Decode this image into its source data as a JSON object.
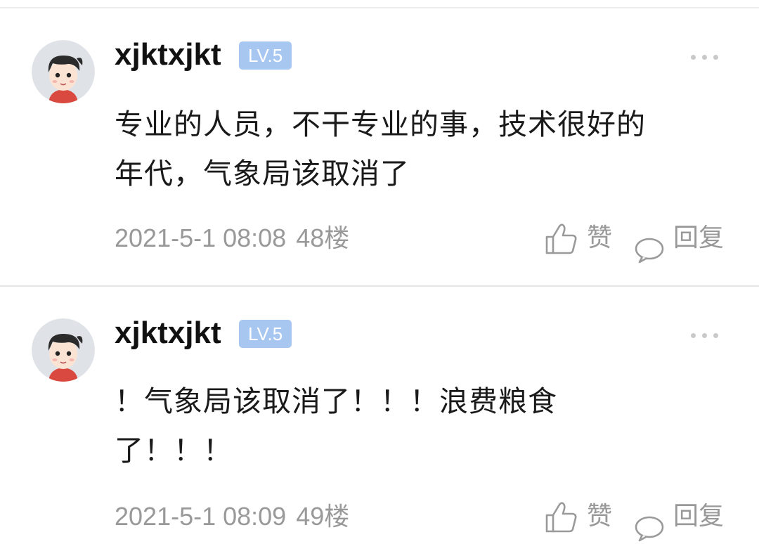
{
  "comments": [
    {
      "username": "xjktxjkt",
      "level": "LV.5",
      "content_lines": [
        "专业的人员，不干专业的事，技术很好的",
        "年代，气象局该取消了"
      ],
      "time": "2021-5-1 08:08",
      "floor": "48楼",
      "like_label": "赞",
      "reply_label": "回复"
    },
    {
      "username": "xjktxjkt",
      "level": "LV.5",
      "content_lines": [
        "！气象局该取消了！！！浪费粮食",
        "了！！！"
      ],
      "time": "2021-5-1 08:09",
      "floor": "49楼",
      "like_label": "赞",
      "reply_label": "回复"
    }
  ],
  "icons": {
    "more": "more-dots-icon",
    "like": "thumbs-up-icon",
    "reply": "speech-bubble-icon",
    "avatar": "cartoon-avatar"
  },
  "colors": {
    "level_badge_bg": "#a7c7f1",
    "meta_text": "#999999",
    "username": "#111111"
  }
}
